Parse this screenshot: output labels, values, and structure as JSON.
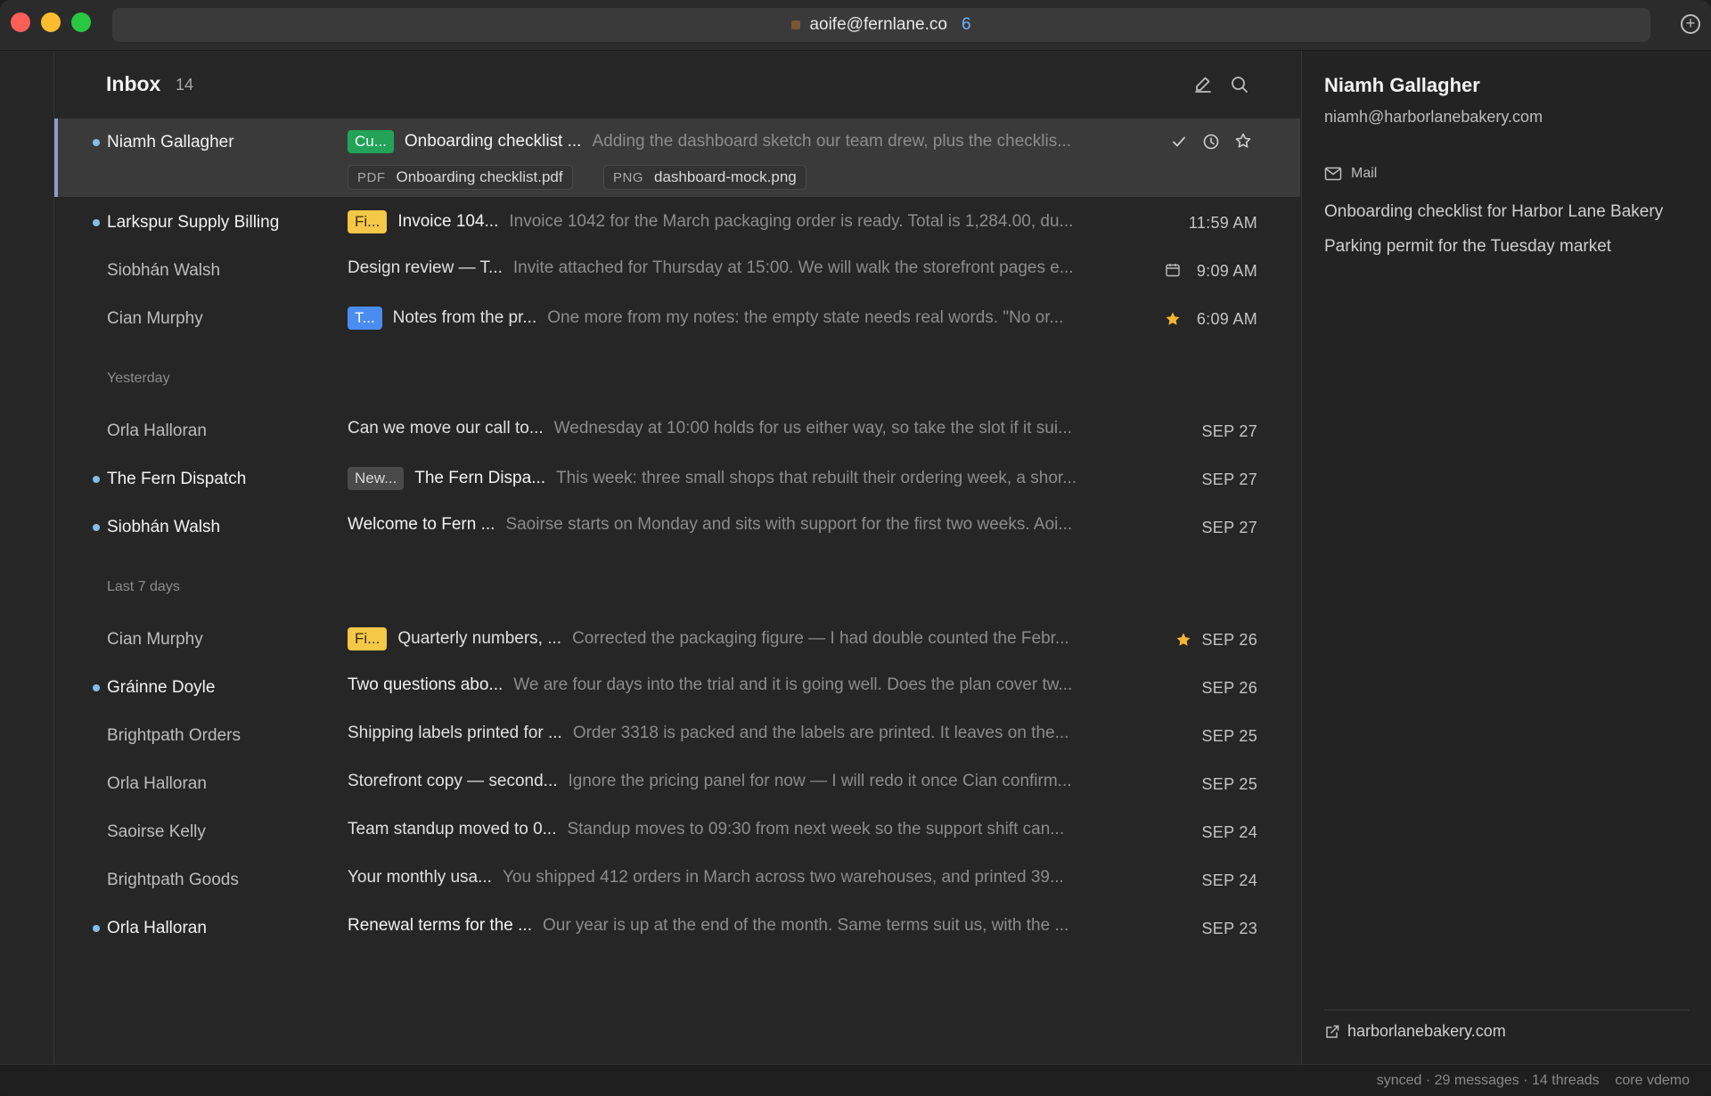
{
  "titlebar": {
    "account": "aoife@fernlane.co",
    "unread_count": "6"
  },
  "inbox": {
    "title": "Inbox",
    "count": "14"
  },
  "rows": [
    {
      "sender": "Niamh Gallagher",
      "unread": true,
      "label": "Cu...",
      "subject": "Onboarding checklist ...",
      "snippet": "Adding the dashboard sketch our team drew, plus the checklis...",
      "attachments": [
        {
          "ext": "PDF",
          "name": "Onboarding checklist.pdf"
        },
        {
          "ext": "PNG",
          "name": "dashboard-mock.png"
        }
      ]
    },
    {
      "sender": "Larkspur Supply Billing",
      "unread": true,
      "label": "Fi...",
      "subject": "Invoice 104...",
      "snippet": "Invoice 1042 for the March packaging order is ready. Total is 1,284.00, du...",
      "date": "11:59 AM"
    },
    {
      "sender": "Siobhán Walsh",
      "unread": false,
      "subject": "Design review — T...",
      "snippet": "Invite attached for Thursday at 15:00. We will walk the storefront pages e...",
      "date": "9:09 AM",
      "icon": "calendar-icon"
    },
    {
      "sender": "Cian Murphy",
      "unread": false,
      "label": "T...",
      "subject": "Notes from the pr...",
      "snippet": "One more from my notes: the empty state needs real words. \"No or...",
      "date": "6:09 AM",
      "icon": "star-icon"
    },
    {
      "sender": "Orla Halloran",
      "unread": false,
      "subject": "Can we move our call to...",
      "snippet": "Wednesday at 10:00 holds for us either way, so take the slot if it sui...",
      "date": "SEP 27"
    },
    {
      "sender": "The Fern Dispatch",
      "unread": true,
      "label": "New...",
      "subject": "The Fern Dispa...",
      "snippet": "This week: three small shops that rebuilt their ordering week, a shor...",
      "date": "SEP 27"
    },
    {
      "sender": "Siobhán Walsh",
      "unread": true,
      "subject": "Welcome to Fern ...",
      "snippet": "Saoirse starts on Monday and sits with support for the first two weeks. Aoi...",
      "date": "SEP 27"
    },
    {
      "sender": "Cian Murphy",
      "unread": false,
      "label": "Fi...",
      "subject": "Quarterly numbers, ...",
      "snippet": "Corrected the packaging figure — I had double counted the Febr...",
      "date": "SEP 26",
      "icon": "star-icon"
    },
    {
      "sender": "Gráinne Doyle",
      "unread": true,
      "subject": "Two questions abo...",
      "snippet": "We are four days into the trial and it is going well. Does the plan cover tw...",
      "date": "SEP 26"
    },
    {
      "sender": "Brightpath Orders",
      "unread": false,
      "subject": "Shipping labels printed for ...",
      "snippet": "Order 3318 is packed and the labels are printed. It leaves on the...",
      "date": "SEP 25"
    },
    {
      "sender": "Orla Halloran",
      "unread": false,
      "subject": "Storefront copy — second...",
      "snippet": "Ignore the pricing panel for now — I will redo it once Cian confirm...",
      "date": "SEP 25"
    },
    {
      "sender": "Saoirse Kelly",
      "unread": false,
      "subject": "Team standup moved to 0...",
      "snippet": "Standup moves to 09:30 from next week so the support shift can...",
      "date": "SEP 24"
    },
    {
      "sender": "Brightpath Goods",
      "unread": false,
      "subject": "Your monthly usa...",
      "snippet": "You shipped 412 orders in March across two warehouses, and printed 39...",
      "date": "SEP 24"
    },
    {
      "sender": "Orla Halloran",
      "unread": true,
      "subject": "Renewal terms for the ...",
      "snippet": "Our year is up at the end of the month. Same terms suit us, with the ...",
      "date": "SEP 23"
    }
  ],
  "sections": {
    "yesterday": "Yesterday",
    "last7": "Last 7 days"
  },
  "colors": {
    "label_green": "#22a357",
    "label_yellow": "#f5c848",
    "label_blue": "#4b8cf0",
    "unread_dot": "#86bde6",
    "star": "#f2b632"
  },
  "panel": {
    "name": "Niamh Gallagher",
    "email": "niamh@harborlanebakery.com",
    "mail_label": "Mail",
    "threads": [
      "Onboarding checklist for Harbor Lane Bakery",
      "Parking permit for the Tuesday market"
    ],
    "website": "harborlanebakery.com"
  },
  "status": {
    "text": "synced · 29 messages · 14 threads    core vdemo"
  }
}
